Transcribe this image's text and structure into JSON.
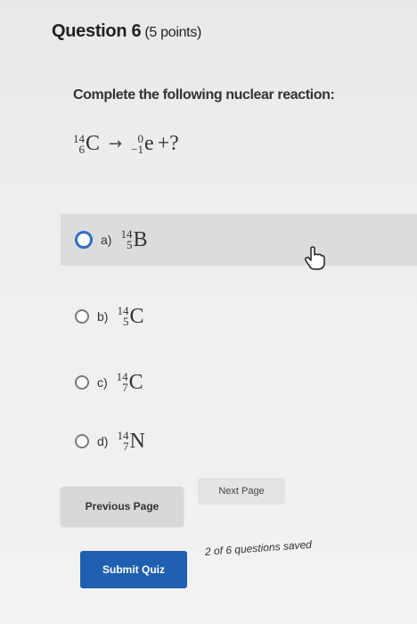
{
  "question": {
    "title": "Question 6",
    "points": "(5 points)",
    "prompt": "Complete the following nuclear reaction:",
    "equation": {
      "reactant": {
        "mass": "14",
        "atomic": "6",
        "symbol": "C"
      },
      "arrow": "→",
      "product": {
        "mass": "0",
        "atomic": "−1",
        "symbol": "e"
      },
      "plus_unknown": "+?"
    }
  },
  "options": [
    {
      "letter": "a)",
      "mass": "14",
      "atomic": "5",
      "symbol": "B",
      "hovered": true
    },
    {
      "letter": "b)",
      "mass": "14",
      "atomic": "5",
      "symbol": "C"
    },
    {
      "letter": "c)",
      "mass": "14",
      "atomic": "7",
      "symbol": "C"
    },
    {
      "letter": "d)",
      "mass": "14",
      "atomic": "7",
      "symbol": "N"
    }
  ],
  "navigation": {
    "previous_label": "Previous Page",
    "next_label": "Next Page",
    "submit_label": "Submit Quiz",
    "save_status": "2 of 6 questions saved"
  },
  "colors": {
    "accent": "#1f5fb0",
    "radio_hover": "#2f6fc4"
  },
  "icons": {
    "cursor": "hand-pointer-icon"
  }
}
